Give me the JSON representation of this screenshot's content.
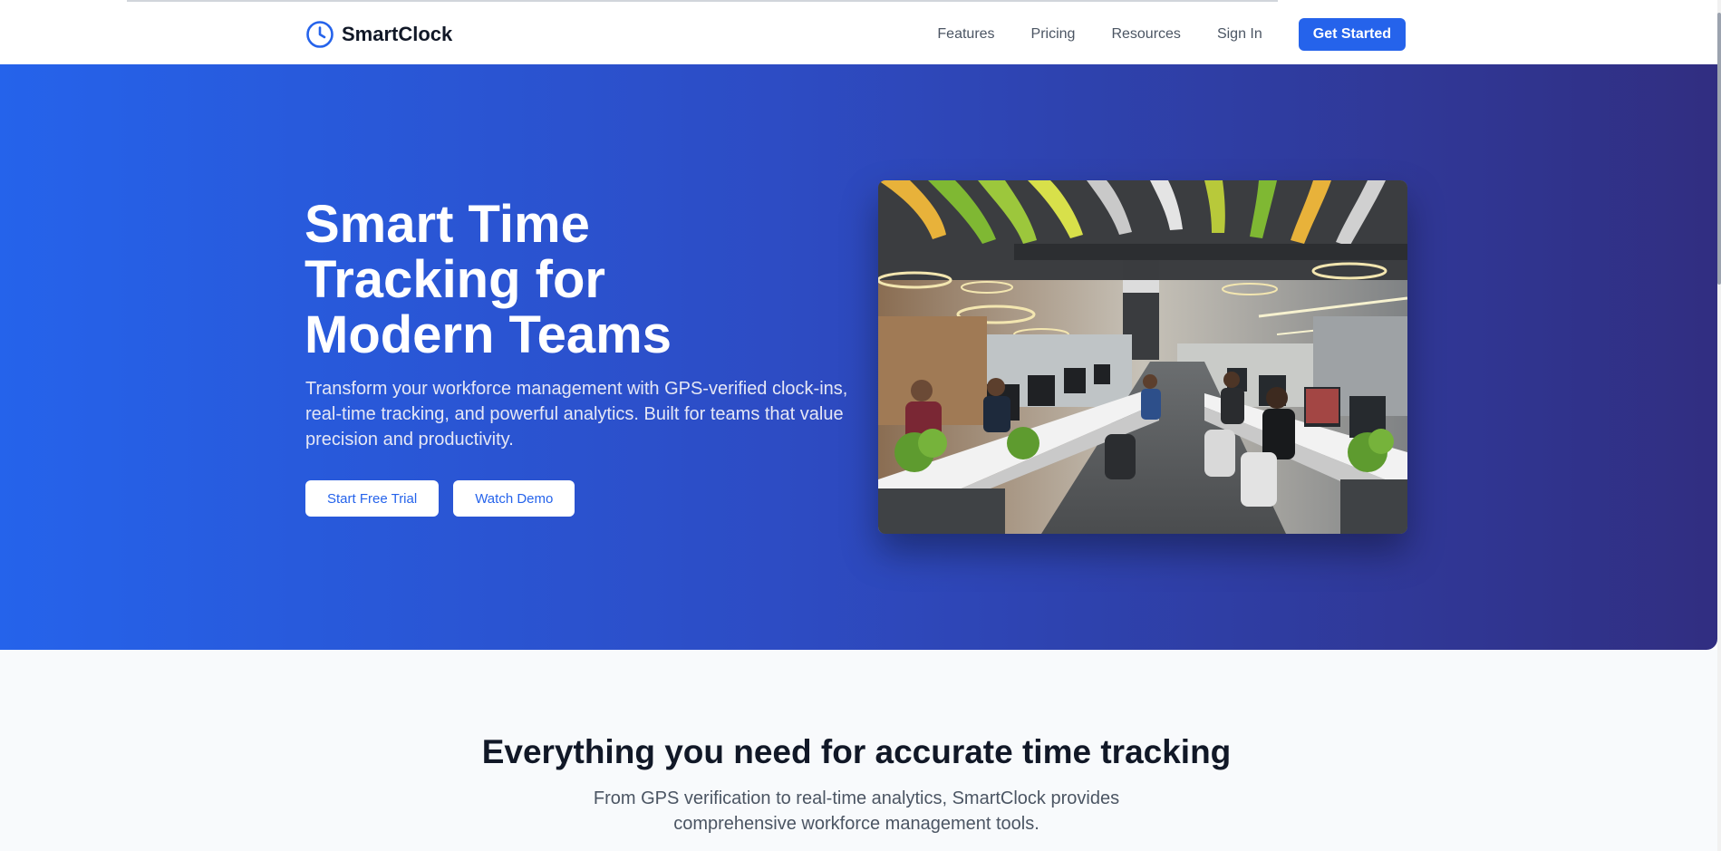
{
  "nav": {
    "brand": "SmartClock",
    "links": [
      "Features",
      "Pricing",
      "Resources",
      "Sign In"
    ],
    "cta": "Get Started"
  },
  "hero": {
    "title_lines": [
      "Smart Time",
      "Tracking for",
      "Modern Teams"
    ],
    "subtitle": "Transform your workforce management with GPS-verified clock-ins, real-time tracking, and powerful analytics. Built for teams that value precision and productivity.",
    "primary_button": "Start Free Trial",
    "secondary_button": "Watch Demo"
  },
  "features": {
    "title": "Everything you need for accurate time tracking",
    "subtitle": "From GPS verification to real-time analytics, SmartClock provides comprehensive workforce management tools."
  },
  "colors": {
    "accent": "#2563eb",
    "hero_gradient_start": "#2563eb",
    "hero_gradient_end": "#312e81"
  },
  "icons": {
    "brand": "clock-icon"
  }
}
